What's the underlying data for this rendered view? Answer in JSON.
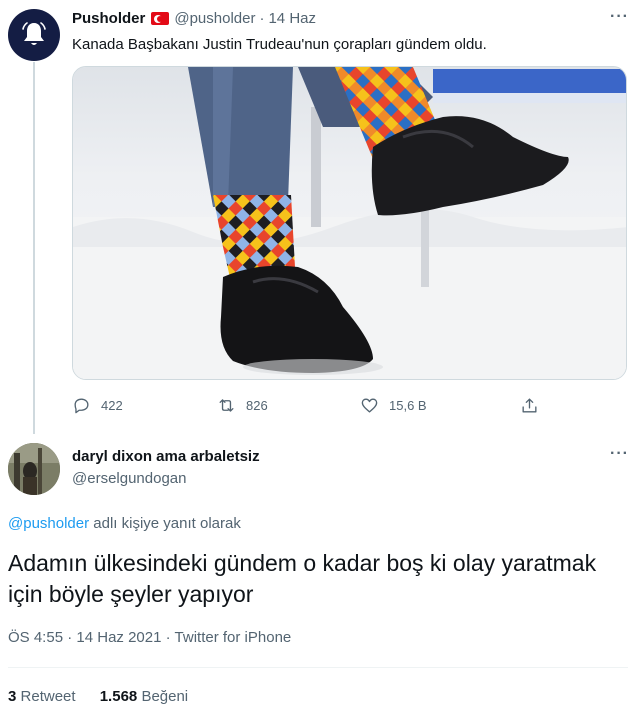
{
  "tweet": {
    "author_name": "Pusholder",
    "author_flag": "turkey-flag",
    "handle": "@pusholder",
    "date": "14 Haz",
    "text": "Kanada Başbakanı Justin Trudeau'nun çorapları gündem oldu.",
    "more_label": "···",
    "media_alt": "",
    "replies": "422",
    "retweets": "826",
    "likes": "15,6 B",
    "colors": {
      "avatar_bg": "#141d44",
      "bell": "#ffffff",
      "muted": "#536471"
    }
  },
  "reply": {
    "author_name": "daryl dixon ama arbaletsiz",
    "handle": "@erselgundogan",
    "more_label": "···",
    "reply_to_mention": "@pusholder",
    "reply_to_suffix": " adlı kişiye yanıt olarak",
    "text": "Adamın ülkesindeki gündem o kadar boş ki olay yaratmak için böyle şeyler yapıyor",
    "time": "ÖS 4:55",
    "date": "14 Haz 2021",
    "source": "Twitter for iPhone",
    "retweet_count": "3",
    "retweet_label": "Retweet",
    "like_count": "1.568",
    "like_label": "Beğeni",
    "colors": {
      "link": "#1d9bf0",
      "text": "#0f1419"
    }
  }
}
